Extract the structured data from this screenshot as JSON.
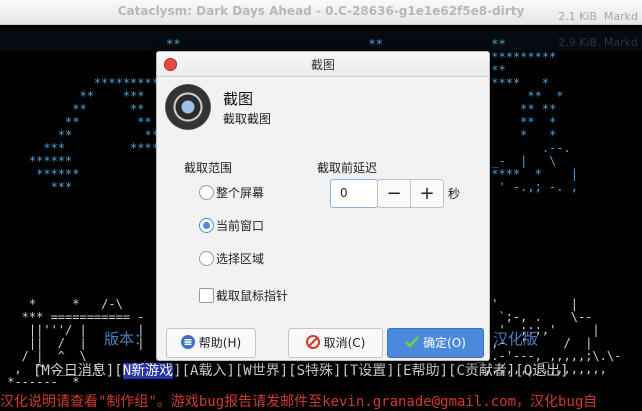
{
  "window": {
    "title": "Cataclysm: Dark Days Ahead - 0.C-28636-g1e1e62f5e8-dirty",
    "size_line": "2.1 KiB  Markd",
    "ghost_size": "2.9 KiB  Markd"
  },
  "terminal": {
    "version_label": "版本：",
    "cn_label": "汉化版",
    "menu_before": "[M今日消息][",
    "menu_selected": "N新游戏",
    "menu_after": "][A载入][W世界][S特殊][T设置][E帮助][C贡献者][Q退出]",
    "status_line": "汉化说明请查看\"制作组\"。游戏bug报告请发邮件至kevin.granade@gmail.com，汉化bug自"
  },
  "dialog": {
    "title": "截图",
    "app_name": "截图",
    "app_subtitle": "截取截图",
    "scope_label": "截取范围",
    "options": [
      "整个屏幕",
      "当前窗口",
      "选择区域"
    ],
    "selected_option": "当前窗口",
    "delay_label": "截取前延迟",
    "delay_value": "0",
    "delay_unit": "秒",
    "minus_label": "−",
    "plus_label": "+",
    "pointer_checkbox_label": "截取鼠标指针",
    "pointer_checked": false,
    "help_button": "帮助(H)",
    "cancel_button": "取消(C)",
    "ok_button": "确定(O)"
  },
  "colors": {
    "accent": "#4a89dc",
    "close": "#e24b4b",
    "status_red": "#d23a2d",
    "menu_select": "#2436a8"
  }
}
